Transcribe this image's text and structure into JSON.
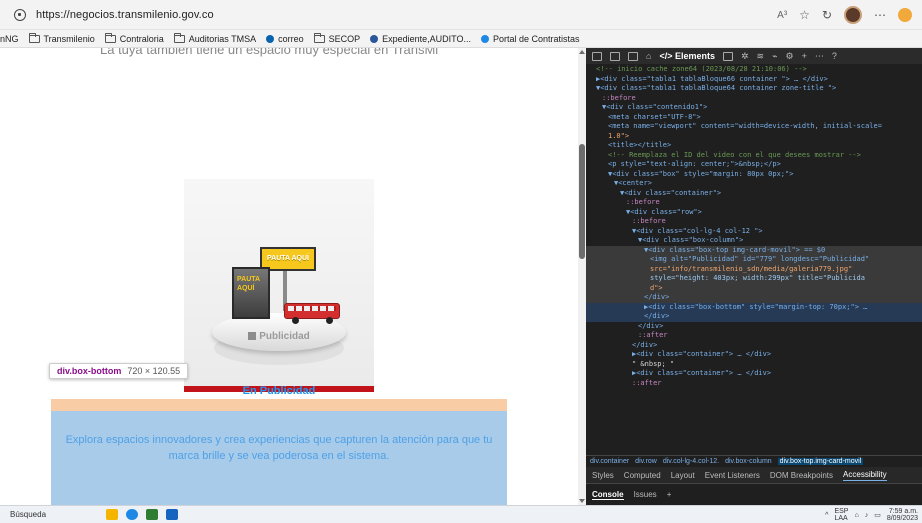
{
  "browser": {
    "url": "https://negocios.transmilenio.gov.co",
    "read_aloud_label": "A³",
    "bookmarks": [
      {
        "label": "nNG",
        "icon": "none"
      },
      {
        "label": "Transmilenio",
        "icon": "folder-icon"
      },
      {
        "label": "Contraloria",
        "icon": "folder-icon"
      },
      {
        "label": "Auditorias TMSA",
        "icon": "folder-icon"
      },
      {
        "label": "correo",
        "icon": "outlook-icon"
      },
      {
        "label": "SECOP",
        "icon": "folder-icon"
      },
      {
        "label": "Expediente,AUDITO...",
        "icon": "document-icon"
      },
      {
        "label": "Portal de Contratistas",
        "icon": "edge-icon"
      }
    ]
  },
  "page": {
    "cut_heading": "La tuya también tiene un espacio muy especial en TransMi",
    "ad_image": {
      "billboard_text": "PAUTA AQUÍ",
      "panel_text_1": "PAUTA",
      "panel_text_2": "AQUÍ",
      "stage_label": "Publicidad"
    },
    "tooltip": {
      "selector": "div.box-bottom",
      "dims": "720 × 120.55"
    },
    "box_title": "En Publicidad",
    "box_description": "Explora espacios innovadores y crea experiencias que capturen la atención para que tu marca brille y se vea poderosa en el sistema."
  },
  "devtools": {
    "tab_elements": "Elements",
    "crumbs": [
      "div.container",
      "div.row",
      "div.col-lg-4.col-12.",
      "div.box-column",
      "div.box-top.img-card-movil"
    ],
    "panel_tabs": [
      "Styles",
      "Computed",
      "Layout",
      "Event Listeners",
      "DOM Breakpoints",
      "Accessibility"
    ],
    "active_panel_tab": "Accessibility",
    "drawer_tabs": [
      "Console",
      "Issues"
    ],
    "dom_lines": [
      {
        "i": 1,
        "text": "<!-- inicio cache zone64 (2023/08/28 21:10:06) -->",
        "cls": "c"
      },
      {
        "i": 1,
        "text": "▶<div class=\"tabla1 tablaBloque66 container \"> … </div>",
        "cls": "t"
      },
      {
        "i": 1,
        "text": "▼<div class=\"tabla1 tablaBloque64 container zone-title \">",
        "cls": "t"
      },
      {
        "i": 2,
        "text": "::before",
        "cls": "ps"
      },
      {
        "i": 2,
        "text": "▼<div class=\"contenido1\">",
        "cls": "t"
      },
      {
        "i": 3,
        "text": "<meta charset=\"UTF-8\">",
        "cls": "t"
      },
      {
        "i": 3,
        "text": "<meta name=\"viewport\" content=\"width=device-width, initial-scale=",
        "cls": "t"
      },
      {
        "i": 3,
        "text": "1.0\">",
        "cls": "v"
      },
      {
        "i": 3,
        "text": "<title></title>",
        "cls": "t"
      },
      {
        "i": 3,
        "text": "<!-- Reemplaza el ID del video con el que desees mostrar -->",
        "cls": "c"
      },
      {
        "i": 3,
        "text": "<p style=\"text-align: center;\">&nbsp;</p>",
        "cls": "t"
      },
      {
        "i": 3,
        "text": "▼<div class=\"box\" style=\"margin: 80px 0px;\">",
        "cls": "t"
      },
      {
        "i": 4,
        "text": "▼<center>",
        "cls": "t"
      },
      {
        "i": 5,
        "text": "▼<div class=\"container\">",
        "cls": "t"
      },
      {
        "i": 6,
        "text": "::before",
        "cls": "ps"
      },
      {
        "i": 6,
        "text": "▼<div class=\"row\">",
        "cls": "t"
      },
      {
        "i": 7,
        "text": "::before",
        "cls": "ps"
      },
      {
        "i": 7,
        "text": "▼<div class=\"col-lg-4 col-12 \">",
        "cls": "t"
      },
      {
        "i": 8,
        "text": "▼<div class=\"box-column\">",
        "cls": "t"
      },
      {
        "i": 9,
        "text": "▼<div class=\"box-top img-card-movil\"> == $0",
        "cls": "t",
        "state": "sel"
      },
      {
        "i": 10,
        "text": "<img alt=\"Publicidad\" id=\"779\" longdesc=\"Publicidad\"",
        "cls": "t",
        "state": "sel"
      },
      {
        "i": 10,
        "text": "src=\"info/transmilenio_sdn/media/galeria779.jpg\"",
        "cls": "v",
        "state": "sel"
      },
      {
        "i": 10,
        "text": "style=\"height: 403px; width:299px\" title=\"Publicida",
        "cls": "a",
        "state": "sel"
      },
      {
        "i": 10,
        "text": "d\">",
        "cls": "v",
        "state": "sel"
      },
      {
        "i": 9,
        "text": "</div>",
        "cls": "t",
        "state": "sel"
      },
      {
        "i": 9,
        "text": "▶<div class=\"box-bottom\" style=\"margin-top: 70px;\"> …",
        "cls": "t",
        "state": "hov"
      },
      {
        "i": 9,
        "text": "</div>",
        "cls": "t",
        "state": "hov"
      },
      {
        "i": 8,
        "text": "</div>",
        "cls": "t"
      },
      {
        "i": 8,
        "text": "::after",
        "cls": "ps"
      },
      {
        "i": 7,
        "text": "</div>",
        "cls": "t"
      },
      {
        "i": 7,
        "text": "▶<div class=\"container\"> … </div>",
        "cls": "t"
      },
      {
        "i": 7,
        "text": "\" &nbsp; \"",
        "cls": "tx"
      },
      {
        "i": 7,
        "text": "▶<div class=\"container\"> … </div>",
        "cls": "t"
      },
      {
        "i": 7,
        "text": "::after",
        "cls": "ps"
      }
    ]
  },
  "taskbar": {
    "search_label": "Búsqueda",
    "lang": "ESP",
    "lang2": "LAA",
    "time": "7:59 a.m.",
    "date": "8/09/2023"
  },
  "colors": {
    "highlight_margin": "#f7c79a",
    "highlight_content": "#a8cbea",
    "brand_red": "#c2131a",
    "devtools_bg": "#1f1f1f"
  }
}
